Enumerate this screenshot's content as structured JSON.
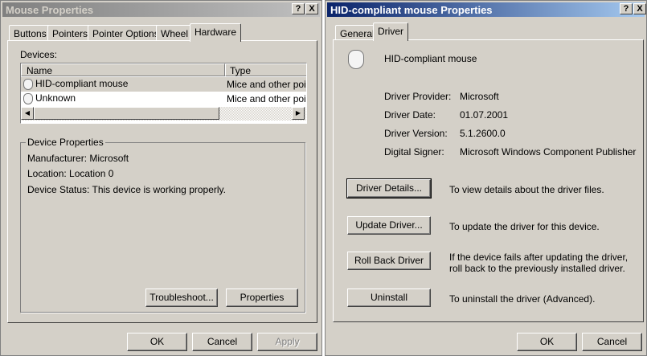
{
  "left": {
    "title": "Mouse Properties",
    "tabs": [
      "Buttons",
      "Pointers",
      "Pointer Options",
      "Wheel",
      "Hardware"
    ],
    "devices_label": "Devices:",
    "columns": [
      "Name",
      "Type"
    ],
    "rows": [
      {
        "name": "HID-compliant mouse",
        "type": "Mice and other point"
      },
      {
        "name": "Unknown",
        "type": "Mice and other point"
      }
    ],
    "group_title": "Device Properties",
    "manufacturer": "Manufacturer: Microsoft",
    "location": "Location: Location 0",
    "status": "Device Status: This device is working properly.",
    "troubleshoot": "Troubleshoot...",
    "properties": "Properties",
    "ok": "OK",
    "cancel": "Cancel",
    "apply": "Apply"
  },
  "right": {
    "title": "HID-compliant mouse Properties",
    "tabs": [
      "General",
      "Driver"
    ],
    "device_name": "HID-compliant mouse",
    "fields": [
      {
        "label": "Driver Provider:",
        "value": "Microsoft"
      },
      {
        "label": "Driver Date:",
        "value": "01.07.2001"
      },
      {
        "label": "Driver Version:",
        "value": "5.1.2600.0"
      },
      {
        "label": "Digital Signer:",
        "value": "Microsoft Windows Component Publisher"
      }
    ],
    "actions": [
      {
        "button": "Driver Details...",
        "desc": "To view details about the driver files."
      },
      {
        "button": "Update Driver...",
        "desc": "To update the driver for this device."
      },
      {
        "button": "Roll Back Driver",
        "desc": "If the device fails after updating the driver, roll back to the previously installed driver."
      },
      {
        "button": "Uninstall",
        "desc": "To uninstall the driver (Advanced)."
      }
    ],
    "ok": "OK",
    "cancel": "Cancel"
  },
  "help": "?",
  "close": "X"
}
